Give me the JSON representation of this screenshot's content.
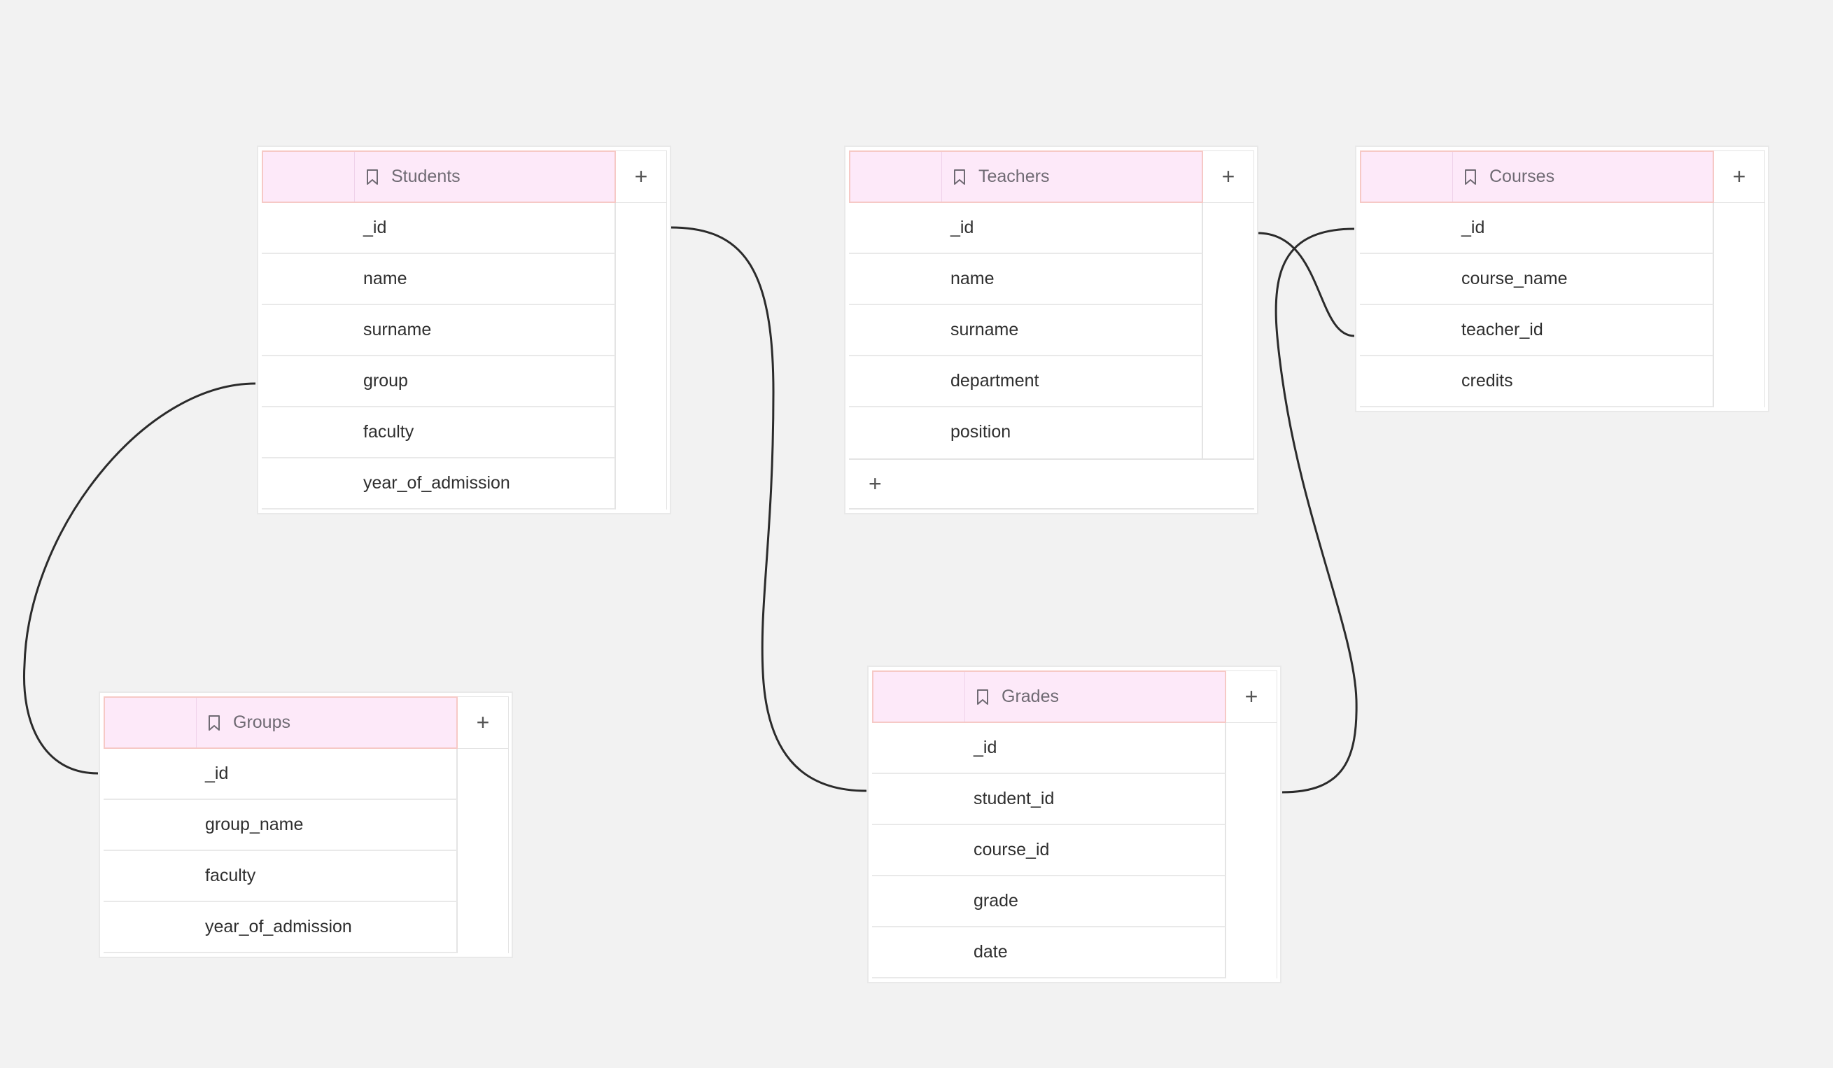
{
  "tables": {
    "students": {
      "title": "Students",
      "fields": [
        "_id",
        "name",
        "surname",
        "group",
        "faculty",
        "year_of_admission"
      ]
    },
    "teachers": {
      "title": "Teachers",
      "fields": [
        "_id",
        "name",
        "surname",
        "department",
        "position"
      ]
    },
    "courses": {
      "title": "Courses",
      "fields": [
        "_id",
        "course_name",
        "teacher_id",
        "credits"
      ]
    },
    "groups": {
      "title": "Groups",
      "fields": [
        "_id",
        "group_name",
        "faculty",
        "year_of_admission"
      ]
    },
    "grades": {
      "title": "Grades",
      "fields": [
        "_id",
        "student_id",
        "course_id",
        "grade",
        "date"
      ]
    }
  },
  "controls": {
    "add_symbol": "+"
  },
  "icons": {
    "header_icon": "bookmark-icon",
    "add_icon": "plus-icon"
  },
  "colors": {
    "canvas": "#f2f2f2",
    "header_fill": "#fde9f9",
    "header_border": "#f6c9c6",
    "connector": "#2b2b2b"
  }
}
